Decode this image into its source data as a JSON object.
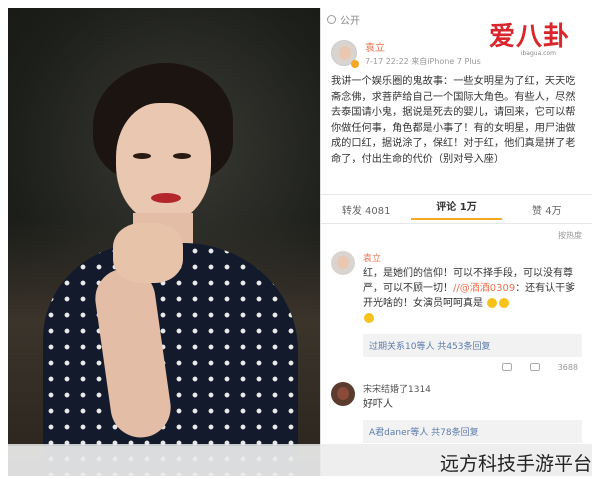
{
  "topbar": {
    "label": "公开"
  },
  "logo": {
    "text": "爱八卦",
    "sub": "ibagua.com"
  },
  "post": {
    "username": "袁立",
    "meta": "7-17 22:22  来自iPhone 7 Plus",
    "body": "我讲一个娱乐圈的鬼故事：一些女明星为了红，天天吃斋念佛，求菩萨给自己一个国际大角色。有些人，尽然去泰国请小鬼，据说是死去的婴儿，请回来，它可以帮你做任何事，角色都是小事了！有的女明星，用尸油做成的口红，据说涂了，保红！对于红，他们真是拼了老命了，付出生命的代价（别对号入座）"
  },
  "actions": {
    "repost": "转发 4081",
    "comment": "评论 1万",
    "like": "赞 4万"
  },
  "hot_label": "按热度",
  "comments": [
    {
      "name": "袁立",
      "text_before": "红，是她们的信仰！可以不择手段，可以没有尊严，可以不顾一切！",
      "mention": "//@酒酒0309",
      "text_after": "：还有认干爹开光啥的！女演员呵呵真是",
      "reply_summary": "过期关系10等人  共453条回复",
      "likes": "3688"
    },
    {
      "name": "宋宋结婚了1314",
      "text": "好吓人",
      "reply_summary": "A君daner等人  共78条回复"
    }
  ],
  "watermark": {
    "text": "远方科技手游平台"
  }
}
